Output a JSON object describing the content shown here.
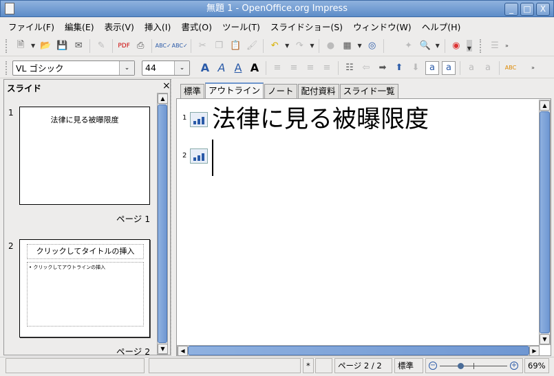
{
  "window": {
    "title": "無題 1 - OpenOffice.org Impress",
    "minimize": "_",
    "maximize": "□",
    "close": "X"
  },
  "menu": [
    "ファイル(F)",
    "編集(E)",
    "表示(V)",
    "挿入(I)",
    "書式(O)",
    "ツール(T)",
    "スライドショー(S)",
    "ウィンドウ(W)",
    "ヘルプ(H)"
  ],
  "toolbar1": {
    "icons": [
      "new-icon",
      "open-icon",
      "save-icon",
      "email-icon",
      "edit-file-icon",
      "export-pdf-icon",
      "print-icon",
      "spellcheck-icon",
      "autospellcheck-icon",
      "cut-icon",
      "copy-icon",
      "paste-icon",
      "format-paintbrush-icon",
      "undo-icon",
      "redo-icon",
      "chart-icon",
      "table-icon",
      "navigator-icon",
      "star-icon",
      "zoom-icon",
      "help-icon"
    ]
  },
  "toolbar2": {
    "font_name": "VL ゴシック",
    "font_size": "44"
  },
  "slides_panel": {
    "title": "スライド",
    "close": "×",
    "slides": [
      {
        "number": "1",
        "title": "法律に見る被曝限度",
        "page_label": "ページ 1"
      },
      {
        "number": "2",
        "title": "クリックしてタイトルの挿入",
        "outline": "• クリックしてアウトラインの挿入",
        "page_label": "ページ 2"
      }
    ]
  },
  "tabs": [
    {
      "label": "標準",
      "active": false
    },
    {
      "label": "アウトライン",
      "active": true
    },
    {
      "label": "ノート",
      "active": false
    },
    {
      "label": "配付資料",
      "active": false
    },
    {
      "label": "スライド一覧",
      "active": false
    }
  ],
  "outline": [
    {
      "number": "1",
      "text": "法律に見る被曝限度"
    },
    {
      "number": "2",
      "text": ""
    }
  ],
  "statusbar": {
    "modified": "*",
    "page": "ページ 2 / 2",
    "layout": "標準",
    "zoom_percent": "69%",
    "zoom_minus": "−",
    "zoom_plus": "+",
    "zoom_level": 69
  }
}
